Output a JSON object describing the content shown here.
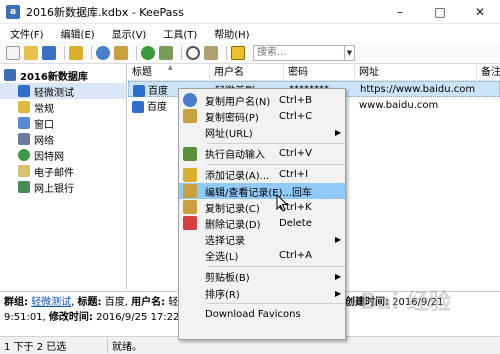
{
  "window": {
    "title": "2016新数据库.kdbx - KeePass",
    "app_icon_glyph": "a",
    "minimize": "–",
    "maximize": "□",
    "close": "✕"
  },
  "menu": [
    "文件(F)",
    "编辑(E)",
    "显示(V)",
    "工具(T)",
    "帮助(H)"
  ],
  "toolbar": {
    "search_placeholder": "搜索...",
    "search_dropdown": "▼"
  },
  "tree": {
    "root": "2016新数据库",
    "children": [
      "轻微测试",
      "常规",
      "窗口",
      "网络",
      "因特网",
      "电子邮件",
      "网上银行"
    ]
  },
  "list": {
    "columns": [
      "标题",
      "用户名",
      "密码",
      "网址",
      "备注"
    ],
    "sort_glyph": "▲",
    "rows": [
      {
        "title": "百度",
        "username": "轻微美剧",
        "password": "********",
        "url": "https://www.baidu.com"
      },
      {
        "title": "百度",
        "username": "",
        "password": "",
        "url": "www.baidu.com"
      }
    ]
  },
  "details": {
    "group_label": "群组:",
    "group_value": "轻微测试",
    "title_label": "标题:",
    "title_value": "百度",
    "user_label": "用户名:",
    "user_value": "轻微美",
    "created_label": "创建时间:",
    "created_value": "2016/9/21",
    "created_value_cont": "9:51:01,",
    "modified_label": "修改时间:",
    "modified_value": "2016/9/25 17:22:40"
  },
  "status": {
    "selection": "1 下于 2 已选",
    "state": "就绪。"
  },
  "context_menu": {
    "items": [
      {
        "label": "复制用户名(N)",
        "shortcut": "Ctrl+B",
        "icon": "user-icon",
        "color": "#4a7ec8"
      },
      {
        "label": "复制密码(P)",
        "shortcut": "Ctrl+C",
        "icon": "key-icon",
        "color": "#c8a040"
      },
      {
        "label": "网址(URL)",
        "shortcut": "",
        "icon": "",
        "submenu": "▶"
      },
      {
        "sep": true
      },
      {
        "label": "执行自动输入",
        "shortcut": "Ctrl+V",
        "icon": "keyboard-icon",
        "color": "#5a8f3a"
      },
      {
        "sep": true
      },
      {
        "label": "添加记录(A)...",
        "shortcut": "Ctrl+I",
        "icon": "add-entry-icon",
        "color": "#d8b030"
      },
      {
        "label": "编辑/查看记录(E)...",
        "shortcut": "回车",
        "icon": "edit-entry-icon",
        "color": "#c8a040",
        "highlight": true
      },
      {
        "label": "复制记录(C)",
        "shortcut": "Ctrl+K",
        "icon": "duplicate-entry-icon",
        "color": "#c8a040"
      },
      {
        "label": "删除记录(D)",
        "shortcut": "Delete",
        "icon": "delete-entry-icon",
        "color": "#d04040"
      },
      {
        "label": "选择记录",
        "shortcut": "",
        "icon": "",
        "submenu": "▶"
      },
      {
        "label": "全选(L)",
        "shortcut": "Ctrl+A",
        "icon": ""
      },
      {
        "sep": true
      },
      {
        "label": "剪贴板(B)",
        "shortcut": "",
        "icon": "",
        "submenu": "▶"
      },
      {
        "label": "排序(R)",
        "shortcut": "",
        "icon": "",
        "submenu": "▶"
      },
      {
        "sep": true
      },
      {
        "label": "Download Favicons",
        "shortcut": "",
        "icon": ""
      }
    ]
  },
  "watermark": "Bai 经验",
  "colors": {
    "selection": "#cce4f7",
    "menu_highlight": "#91c9f7",
    "link": "#0b4fb4"
  }
}
